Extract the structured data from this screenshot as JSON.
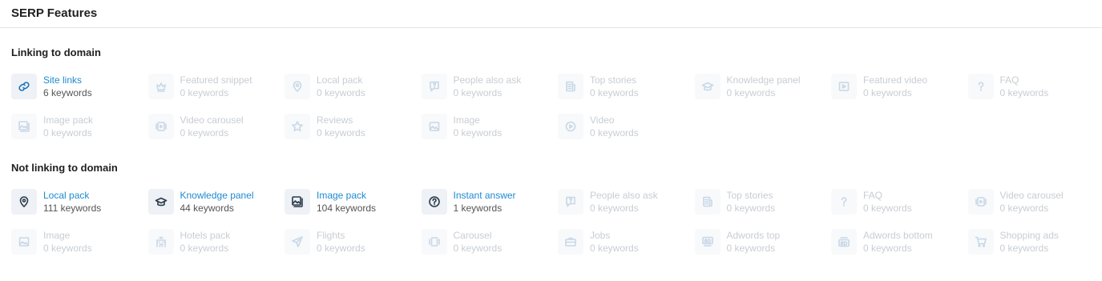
{
  "page": {
    "title": "SERP Features"
  },
  "linking": {
    "title": "Linking to domain",
    "items": [
      {
        "name": "Site links",
        "count": "6 keywords",
        "icon": "link-icon",
        "active": true,
        "primary": true
      },
      {
        "name": "Featured snippet",
        "count": "0 keywords",
        "icon": "trophy-icon",
        "active": false
      },
      {
        "name": "Local pack",
        "count": "0 keywords",
        "icon": "map-pin-icon",
        "active": false
      },
      {
        "name": "People also ask",
        "count": "0 keywords",
        "icon": "question-bubble-icon",
        "active": false
      },
      {
        "name": "Top stories",
        "count": "0 keywords",
        "icon": "news-icon",
        "active": false
      },
      {
        "name": "Knowledge panel",
        "count": "0 keywords",
        "icon": "graduation-cap-icon",
        "active": false
      },
      {
        "name": "Featured video",
        "count": "0 keywords",
        "icon": "video-frame-icon",
        "active": false
      },
      {
        "name": "FAQ",
        "count": "0 keywords",
        "icon": "question-mark-icon",
        "active": false
      },
      {
        "name": "Image pack",
        "count": "0 keywords",
        "icon": "image-pack-icon",
        "active": false
      },
      {
        "name": "Video carousel",
        "count": "0 keywords",
        "icon": "video-carousel-icon",
        "active": false
      },
      {
        "name": "Reviews",
        "count": "0 keywords",
        "icon": "star-icon",
        "active": false
      },
      {
        "name": "Image",
        "count": "0 keywords",
        "icon": "image-icon",
        "active": false
      },
      {
        "name": "Video",
        "count": "0 keywords",
        "icon": "play-circle-icon",
        "active": false
      }
    ]
  },
  "not_linking": {
    "title": "Not linking to domain",
    "items": [
      {
        "name": "Local pack",
        "count": "111 keywords",
        "icon": "map-pin-icon",
        "active": true
      },
      {
        "name": "Knowledge panel",
        "count": "44 keywords",
        "icon": "graduation-cap-icon",
        "active": true
      },
      {
        "name": "Image pack",
        "count": "104 keywords",
        "icon": "image-pack-icon",
        "active": true
      },
      {
        "name": "Instant answer",
        "count": "1 keywords",
        "icon": "question-circle-icon",
        "active": true
      },
      {
        "name": "People also ask",
        "count": "0 keywords",
        "icon": "question-bubble-icon",
        "active": false
      },
      {
        "name": "Top stories",
        "count": "0 keywords",
        "icon": "news-icon",
        "active": false
      },
      {
        "name": "FAQ",
        "count": "0 keywords",
        "icon": "question-mark-icon",
        "active": false
      },
      {
        "name": "Video carousel",
        "count": "0 keywords",
        "icon": "video-carousel-icon",
        "active": false
      },
      {
        "name": "Image",
        "count": "0 keywords",
        "icon": "image-icon",
        "active": false
      },
      {
        "name": "Hotels pack",
        "count": "0 keywords",
        "icon": "hotel-icon",
        "active": false
      },
      {
        "name": "Flights",
        "count": "0 keywords",
        "icon": "plane-icon",
        "active": false
      },
      {
        "name": "Carousel",
        "count": "0 keywords",
        "icon": "carousel-icon",
        "active": false
      },
      {
        "name": "Jobs",
        "count": "0 keywords",
        "icon": "briefcase-icon",
        "active": false
      },
      {
        "name": "Adwords top",
        "count": "0 keywords",
        "icon": "ad-top-icon",
        "active": false
      },
      {
        "name": "Adwords bottom",
        "count": "0 keywords",
        "icon": "ad-bottom-icon",
        "active": false
      },
      {
        "name": "Shopping ads",
        "count": "0 keywords",
        "icon": "cart-icon",
        "active": false
      }
    ]
  },
  "colors": {
    "link_active": "#1f8ad0",
    "text_inactive": "#c8cdd3",
    "icon_bg_active": "#eef1f5"
  }
}
